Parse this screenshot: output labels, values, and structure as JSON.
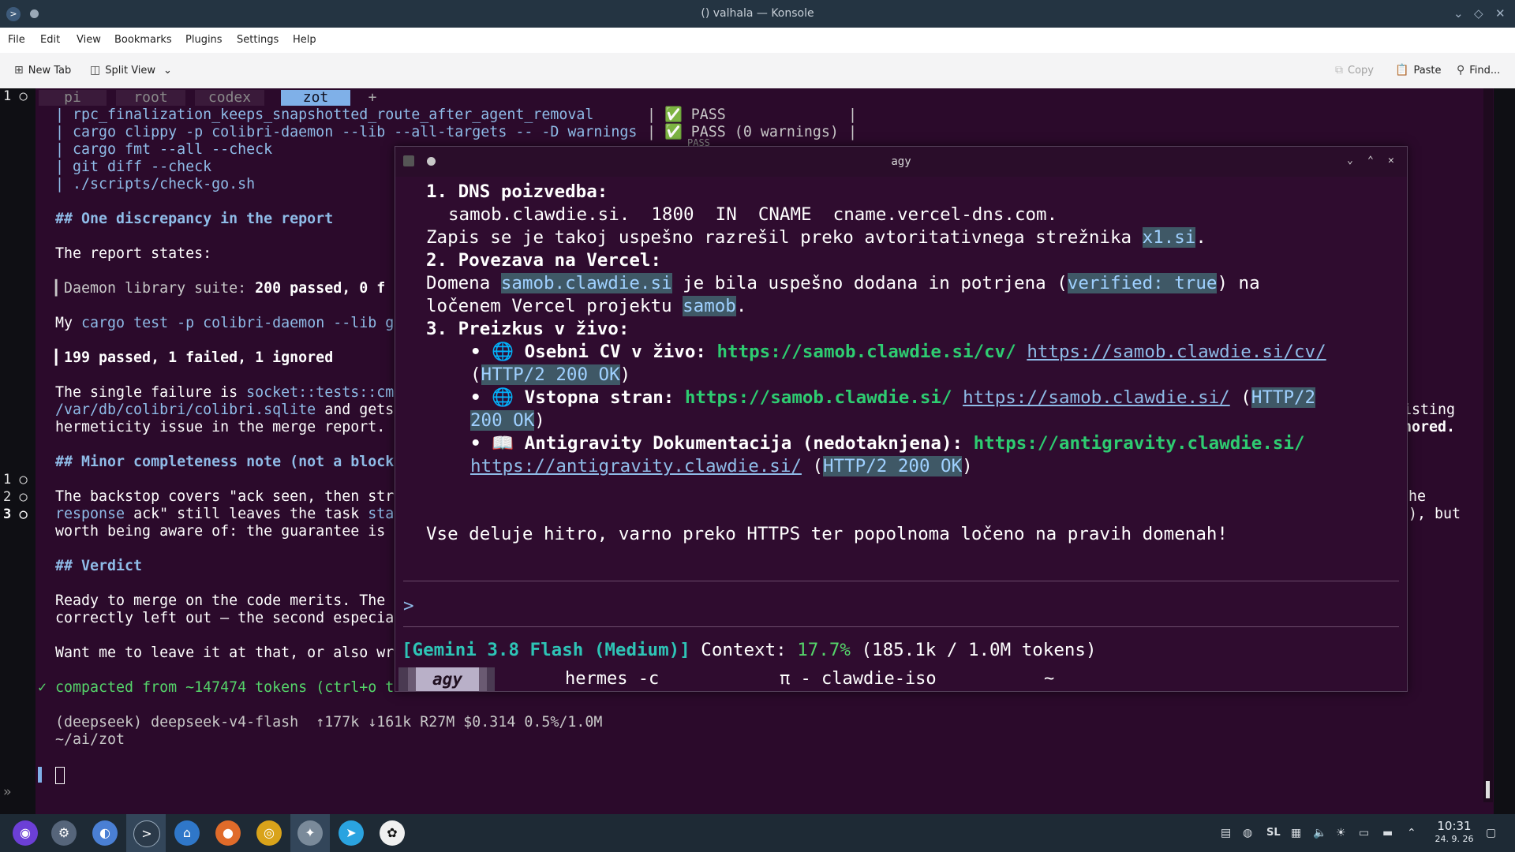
{
  "window": {
    "title": "() valhala — Konsole"
  },
  "menu": [
    "File",
    "Edit",
    "View",
    "Bookmarks",
    "Plugins",
    "Settings",
    "Help"
  ],
  "toolbar": {
    "new_tab": "New Tab",
    "split_view": "Split View",
    "copy": "Copy",
    "paste": "Paste",
    "find": "Find..."
  },
  "tmux": {
    "tabs": [
      "pi",
      "root",
      "codex",
      "zot"
    ],
    "active_tab": "zot",
    "add": "+",
    "gutter_top": "1 ○",
    "gutter_panes": [
      "1 ○",
      "2 ○",
      "3 ○"
    ],
    "gutter_more": "»"
  },
  "terminal": {
    "lines": {
      "l1_cmd": "| rpc_finalization_keeps_snapshotted_route_after_agent_removal",
      "l1_res": "| ✅ PASS",
      "l1_end": "|",
      "l2_cmd": "| cargo clippy -p colibri-daemon --lib --all-targets -- -D warnings",
      "l2_res": "| ✅ PASS (0 warnings)",
      "l2_end": "|",
      "l3_cmd": "| cargo fmt --all --check",
      "l3_res": "PASS",
      "l4_cmd": "| git diff --check",
      "l5_cmd": "| ./scripts/check-go.sh",
      "h1": "## One discrepancy in the report",
      "p1": "The report states:",
      "q1_pre": "▎Daemon library suite: ",
      "q1_bold": "200 passed, 0 f",
      "p2_pre": "My ",
      "p2_code": "cargo test -p colibri-daemon --lib g",
      "q2": "▎199 passed, 1 failed, 1 ignored",
      "p3_pre": "The single failure is ",
      "p3_code": "socket::tests::cm",
      "p3_right": "isting",
      "p4_code": "/var/db/colibri/colibri.sqlite",
      "p4_rest": " and gets",
      "p4_right": "nored.",
      "p5": "hermeticity issue in the merge report.",
      "h2": "## Minor completeness note (not a block",
      "p6": "The backstop covers \"ack seen, then str",
      "p6_right": "he",
      "p7_code": "response",
      "p7_rest": " ack\" still leaves the task ",
      "p7_code2": "sta",
      "p7_right": "), but",
      "p8": "worth being aware of: the guarantee is",
      "h3": "## Verdict",
      "p9": "Ready to merge on the code merits. The",
      "p10": "correctly left out — the second especia",
      "p11": "Want me to leave it at that, or also wr",
      "compact": "✓ compacted from ~147474 tokens (ctrl+o t",
      "status": "(deepseek) deepseek-v4-flash  ↑177k ↓161k R27M $0.314 0.5%/1.0M",
      "cwd": "~/ai/zot"
    }
  },
  "popup": {
    "title": "agy",
    "controls": [
      "⌄",
      "⌃",
      "✕"
    ],
    "s1_head": "1. DNS poizvedba:",
    "s1_record": "samob.clawdie.si.  1800  IN  CNAME  cname.vercel-dns.com.",
    "s1_text_pre": "Zapis se je takoj uspešno razrešil preko avtoritativnega strežnika ",
    "s1_server": "x1.si",
    "s1_text_post": ".",
    "s2_head": "2. Povezava na Vercel:",
    "s2_pre": "Domena ",
    "s2_domain": "samob.clawdie.si",
    "s2_mid": " je bila uspešno dodana in potrjena (",
    "s2_verified": "verified: true",
    "s2_post": ") na",
    "s2_line2_pre": "ločenem Vercel projektu ",
    "s2_project": "samob",
    "s2_line2_post": ".",
    "s3_head": "3. Preizkus v živo:",
    "b1_label": "• 🌐 Osebni CV v živo: ",
    "b1_url": "https://samob.clawdie.si/cv/",
    "b1_link": "https://samob.clawdie.si/cv/",
    "b1_status": "HTTP/2 200 OK",
    "b2_label": "• 🌐 Vstopna stran: ",
    "b2_url": "https://samob.clawdie.si/",
    "b2_link": "https://samob.clawdie.si/",
    "b2_status_a": "HTTP/2",
    "b2_status_b": "200 OK",
    "b3_label": "• 📖 Antigravity Dokumentacija (nedotaknjena): ",
    "b3_url": "https://antigravity.clawdie.si/",
    "b3_link": "https://antigravity.clawdie.si/",
    "b3_status": "HTTP/2 200 OK",
    "summary": "Vse deluje hitro, varno preko HTTPS ter popolnoma ločeno na pravih domenah!",
    "prompt": ">",
    "model": "[Gemini 3.8 Flash (Medium)]",
    "context_label": " Context: ",
    "context_pct": "17.7%",
    "context_tokens": " (185.1k / 1.0M tokens)",
    "tabs": [
      "agy",
      "hermes -c",
      "π - clawdie-iso",
      "~"
    ]
  },
  "taskbar": {
    "tray": {
      "lang": "SL",
      "time": "10:31",
      "date": "24. 9. 26"
    }
  },
  "colors": {
    "terminal_bg": "#2b0a2b",
    "accent_blue": "#8fbce8",
    "green": "#2ecc71"
  }
}
